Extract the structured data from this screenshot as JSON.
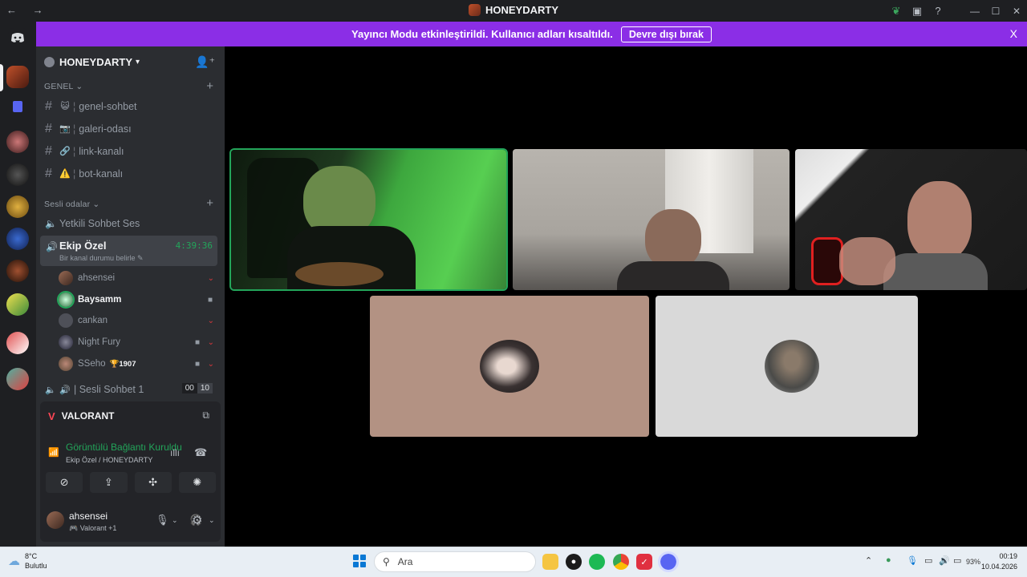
{
  "window": {
    "title": "HONEYDARTY",
    "nav_arrows": "← →"
  },
  "banner": {
    "message": "Yayıncı Modu etkinleştirildi. Kullanıcı adları kısaltıldı.",
    "button_label": "Devre dışı bırak",
    "close": "X"
  },
  "server": {
    "name": "HONEYDARTY",
    "categories": [
      {
        "label": "GENEL ⌄"
      },
      {
        "label": "Sesli odalar ⌄"
      }
    ],
    "text_channels": [
      {
        "emoji": "😺",
        "name": "genel-sohbet"
      },
      {
        "emoji": "📷",
        "name": "galeri-odası"
      },
      {
        "emoji": "🔗",
        "name": "link-kanalı"
      },
      {
        "emoji": "⚠️",
        "name": "bot-kanalı"
      }
    ],
    "voice_channels": [
      {
        "name": "Yetkili Sohbet Ses"
      }
    ],
    "active_voice": {
      "name": "Ekip Özel",
      "timer": "4:39:36",
      "status": "Bir kanal durumu belirle"
    },
    "members": [
      {
        "name": "ahsensei",
        "bold": false,
        "badge": "",
        "video": false,
        "muted": true
      },
      {
        "name": "Baysamm",
        "bold": true,
        "badge": "",
        "video": true,
        "muted": false
      },
      {
        "name": "cankan",
        "bold": false,
        "badge": "",
        "video": false,
        "muted": true
      },
      {
        "name": "Night Fury",
        "bold": false,
        "badge": "",
        "video": true,
        "muted": true
      },
      {
        "name": "SSeho",
        "bold": false,
        "badge": "🏆1907",
        "video": true,
        "muted": true
      }
    ],
    "next_voice": {
      "name": "| Sesli Sohbet 1",
      "count_left": "00",
      "count_right": "10"
    }
  },
  "activity": {
    "game": "VALORANT",
    "connection": "Görüntülü Bağlantı Kuruldu",
    "connection_sub": "Ekip Özel / HONEYDARTY"
  },
  "user": {
    "name": "ahsensei",
    "status": "Valorant +1"
  },
  "colors": {
    "accent_banner": "#8b2ee6",
    "connected_green": "#23a55a",
    "sidebar_bg": "#2b2d31",
    "rail_bg": "#1e1f22"
  },
  "taskbar": {
    "weather_temp": "8°C",
    "weather_desc": "Bulutlu",
    "search_placeholder": "Ara",
    "battery": "93%",
    "time": "00:19",
    "date": "10.04.2026"
  }
}
